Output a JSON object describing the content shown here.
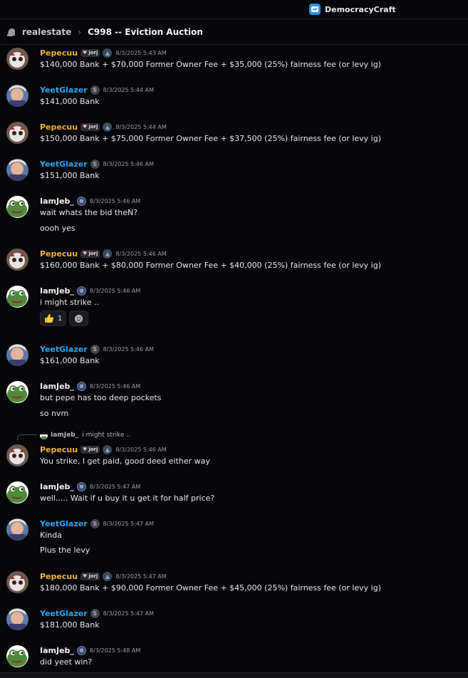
{
  "server": {
    "name": "DemocracyCraft"
  },
  "header": {
    "channel": "realestate",
    "separator": "›",
    "thread": "C998 -- Eviction Auction"
  },
  "colors": {
    "pepecuu": "#f0b232",
    "yeetglazer": "#2fa7ef",
    "iamjeb": "#f2f3f5",
    "background": "#070709"
  },
  "badges": {
    "pepe_tag": "jorj",
    "yeet_badge": "S"
  },
  "messages": [
    {
      "author": "Pepecuu",
      "time": "8/3/2025 5:43 AM",
      "lines": [
        "$140,000 Bank + $70,000 Former Owner Fee + $35,000 (25%) fairness fee (or levy ig)"
      ]
    },
    {
      "author": "YeetGlazer",
      "time": "8/3/2025 5:44 AM",
      "lines": [
        "$141,000 Bank"
      ]
    },
    {
      "author": "Pepecuu",
      "time": "8/3/2025 5:44 AM",
      "lines": [
        "$150,000 Bank + $75,000 Former Owner Fee + $37,500 (25%) fairness fee (or levy ig)"
      ]
    },
    {
      "author": "YeetGlazer",
      "time": "8/3/2025 5:46 AM",
      "lines": [
        "$151,000 Bank"
      ]
    },
    {
      "author": "IamJeb_",
      "time": "8/3/2025 5:46 AM",
      "lines": [
        "wait whats the bid theN?",
        "oooh yes"
      ]
    },
    {
      "author": "Pepecuu",
      "time": "8/3/2025 5:46 AM",
      "lines": [
        "$160,000 Bank + $80,000 Former Owner Fee + $40,000 (25%) fairness fee (or levy ig)"
      ]
    },
    {
      "author": "IamJeb_",
      "time": "8/3/2025 5:46 AM",
      "lines": [
        "i might strike .."
      ],
      "reaction": {
        "emoji": "thumbs-up",
        "count": "1"
      }
    },
    {
      "author": "YeetGlazer",
      "time": "8/3/2025 5:46 AM",
      "lines": [
        "$161,000 Bank"
      ]
    },
    {
      "author": "IamJeb_",
      "time": "8/3/2025 5:46 AM",
      "lines": [
        "but pepe has too deep pockets",
        "so nvm"
      ]
    },
    {
      "author": "Pepecuu",
      "time": "8/3/2025 5:46 AM",
      "lines": [
        "You strike, I get paid, good deed either way"
      ],
      "reply": {
        "author": "IamJeb_",
        "text": "i might strike .."
      }
    },
    {
      "author": "IamJeb_",
      "time": "8/3/2025 5:47 AM",
      "lines": [
        "well..... Wait if u buy it u get it for half price?"
      ]
    },
    {
      "author": "YeetGlazer",
      "time": "8/3/2025 5:47 AM",
      "lines": [
        "Kinda",
        "Plus the levy"
      ]
    },
    {
      "author": "Pepecuu",
      "time": "8/3/2025 5:47 AM",
      "lines": [
        "$180,000 Bank + $90,000 Former Owner Fee + $45,000 (25%) fairness fee (or levy ig)"
      ]
    },
    {
      "author": "YeetGlazer",
      "time": "8/3/2025 5:47 AM",
      "lines": [
        "$181,000 Bank"
      ]
    },
    {
      "author": "IamJeb_",
      "time": "8/3/2025 5:48 AM",
      "lines": [
        "did yeet win?"
      ]
    }
  ]
}
